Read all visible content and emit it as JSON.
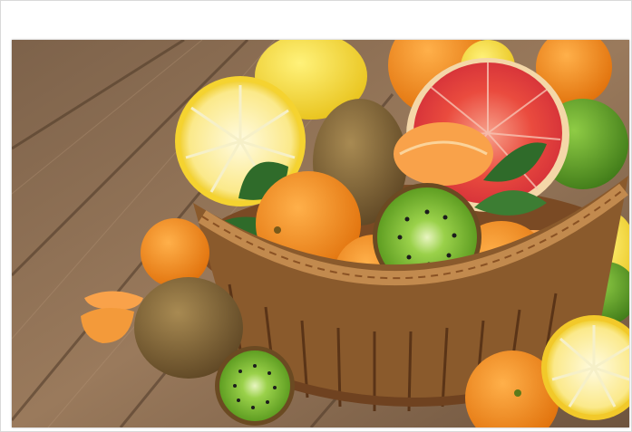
{
  "image": {
    "colors": {
      "wood_light": "#9a7a5c",
      "wood_dark": "#5e4632",
      "basket": "#a86f3c",
      "basket_dark": "#6f4220",
      "orange": "#f08a1c",
      "lemon": "#f7d93a",
      "lime": "#6aa82a",
      "grapefruit": "#e8443c",
      "kiwi_skin": "#8b6d3a",
      "kiwi_flesh": "#8cc63f",
      "leaf": "#2f6b2a"
    }
  }
}
